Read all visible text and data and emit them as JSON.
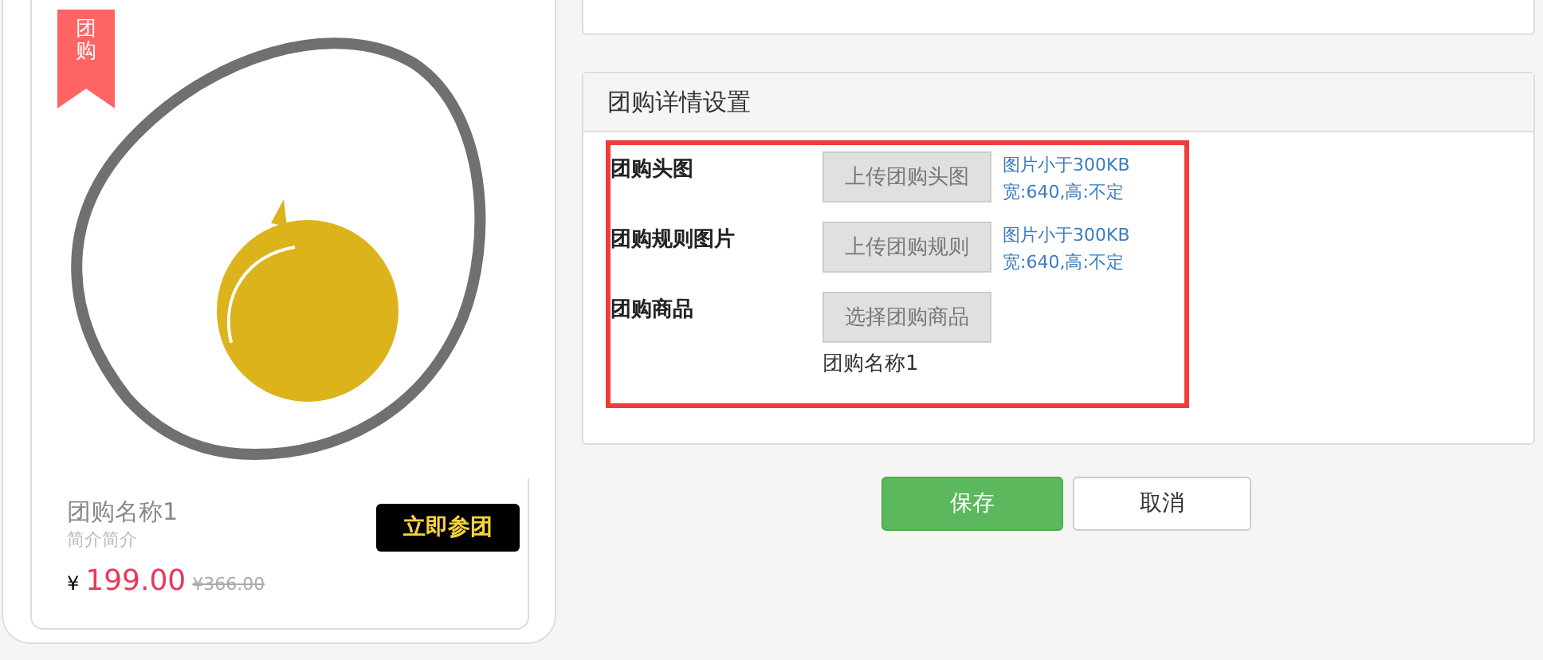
{
  "preview": {
    "ribbon": "团购",
    "name": "团购名称1",
    "intro": "简介简介",
    "currency": "¥",
    "price": "199.00",
    "original_price": "¥366.00",
    "join_button": "立即参团"
  },
  "detail_panel": {
    "title": "团购详情设置",
    "highlighted": true,
    "rows": [
      {
        "label": "团购头图",
        "button": "上传团购头图",
        "hints": [
          "图片小于300KB",
          "宽:640,高:不定"
        ]
      },
      {
        "label": "团购规则图片",
        "button": "上传团购规则",
        "hints": [
          "图片小于300KB",
          "宽:640,高:不定"
        ]
      },
      {
        "label": "团购商品",
        "button": "选择团购商品",
        "value": "团购名称1"
      }
    ]
  },
  "actions": {
    "save": "保存",
    "cancel": "取消"
  }
}
